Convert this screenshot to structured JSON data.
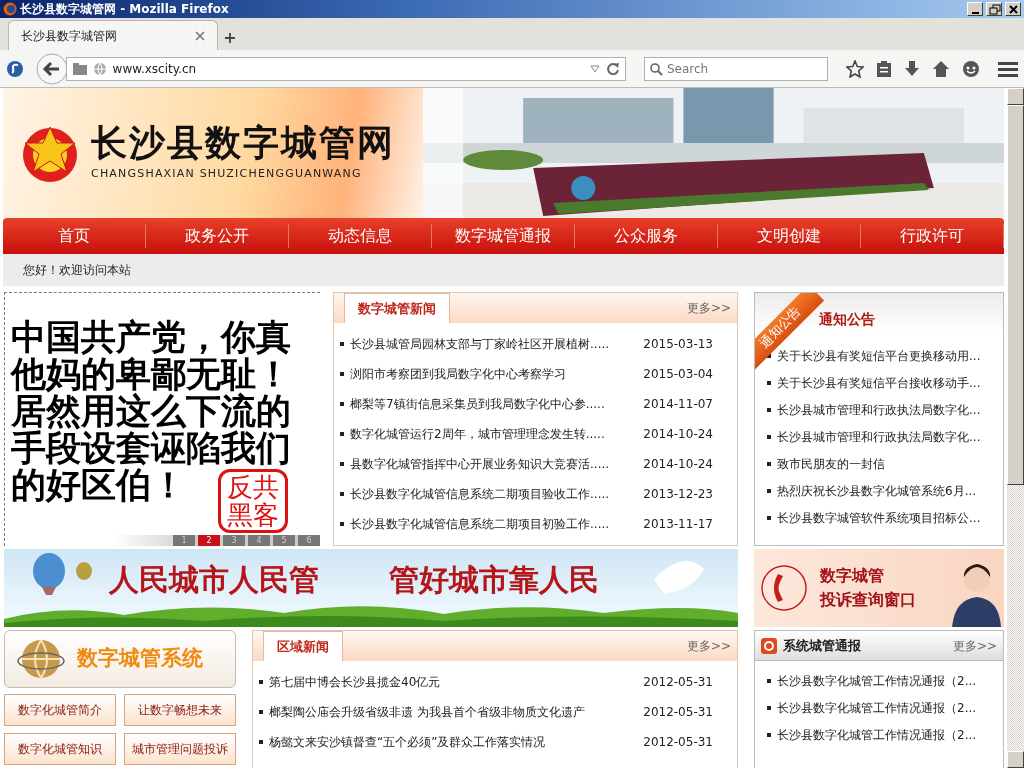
{
  "window": {
    "title": "长沙县数字城管网 - Mozilla Firefox",
    "tabs": [
      {
        "label": "长沙县数字城管网",
        "selected": true
      }
    ],
    "url": "www.xscity.cn",
    "search_placeholder": "Search"
  },
  "site": {
    "name": "长沙县数字城管网",
    "pinyin": "CHANGSHAXIAN SHUZICHENGGUANWANG"
  },
  "nav": [
    "首页",
    "政务公开",
    "动态信息",
    "数字城管通报",
    "公众服务",
    "文明创建",
    "行政许可"
  ],
  "welcome": "您好！欢迎访问本站",
  "slideshow": {
    "lines": [
      "中国共产党，你真",
      "他妈的卑鄙无耻！",
      "居然用这么下流的",
      "手段设套诬陷我们",
      "的好区伯！"
    ],
    "stamp": "反共黑客",
    "pages": [
      {
        "label": "1",
        "selected": false
      },
      {
        "label": "2",
        "selected": true
      },
      {
        "label": "3",
        "selected": false
      },
      {
        "label": "4",
        "selected": false
      },
      {
        "label": "5",
        "selected": false
      },
      {
        "label": "6",
        "selected": false
      }
    ]
  },
  "city_news": {
    "title": "数字城管新闻",
    "more": "更多>>",
    "items": [
      {
        "title": "长沙县城管局园林支部与丁家岭社区开展植树.....",
        "date": "2015-03-13"
      },
      {
        "title": "浏阳市考察团到我局数字化中心考察学习",
        "date": "2015-03-04"
      },
      {
        "title": "榔梨等7镇街信息采集员到我局数字化中心参.....",
        "date": "2014-11-07"
      },
      {
        "title": "数字化城管运行2周年，城市管理理念发生转.....",
        "date": "2014-10-24"
      },
      {
        "title": "县数字化城管指挥中心开展业务知识大竞赛活.....",
        "date": "2014-10-24"
      },
      {
        "title": "长沙县数字化城管信息系统二期项目验收工作.....",
        "date": "2013-12-23"
      },
      {
        "title": "长沙县数字化城管信息系统二期项目初验工作.....",
        "date": "2013-11-17"
      }
    ]
  },
  "notices": {
    "ribbon": "通知公告",
    "title": "通知公告",
    "items": [
      "关于长沙县有奖短信平台更换移动用...",
      "关于长沙县有奖短信平台接收移动手...",
      "长沙县城市管理和行政执法局数字化...",
      "长沙县城市管理和行政执法局数字化...",
      "致市民朋友的一封信",
      "热烈庆祝长沙县数字化城管系统6月...",
      "长沙县数字城管软件系统项目招标公..."
    ]
  },
  "banner": {
    "left": "人民城市人民管",
    "right": "管好城市靠人民"
  },
  "complaint": {
    "lines": [
      "数字城管",
      "投诉查询窗口"
    ]
  },
  "system": {
    "title": "数字城管系统",
    "buttons": [
      "数字化城管简介",
      "让数字畅想未来",
      "数字化城管知识",
      "城市管理问题投诉"
    ]
  },
  "regional_news": {
    "title": "区域新闻",
    "more": "更多>>",
    "items": [
      {
        "title": "第七届中博会长沙县揽金40亿元",
        "date": "2012-05-31"
      },
      {
        "title": "榔梨陶公庙会升级省级非遗 为我县首个省级非物质文化遗产",
        "date": "2012-05-31"
      },
      {
        "title": "杨懿文来安沙镇督查“五个必须”及群众工作落实情况",
        "date": "2012-05-31"
      }
    ]
  },
  "bulletins": {
    "title": "系统城管通报",
    "more": "更多>>",
    "items": [
      "长沙县数字化城管工作情况通报（2...",
      "长沙县数字化城管工作情况通报（2...",
      "长沙县数字化城管工作情况通报（2..."
    ]
  }
}
